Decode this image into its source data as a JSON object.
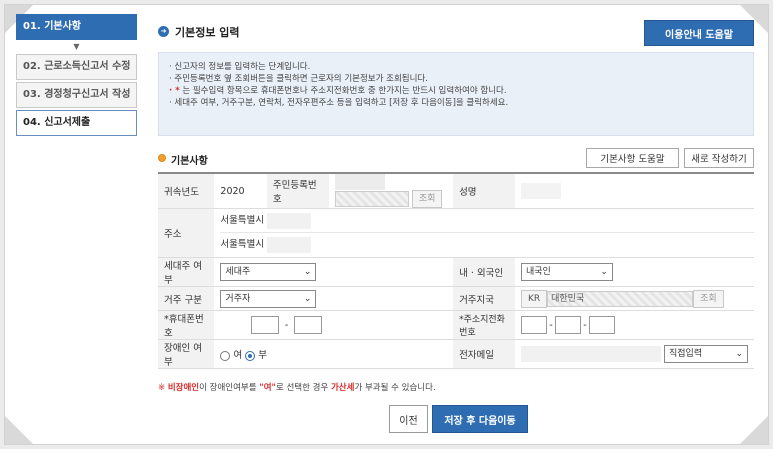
{
  "steps": [
    {
      "label": "01. 기본사항",
      "state": "active"
    },
    {
      "label": "02. 근로소득신고서 수정",
      "state": "normal"
    },
    {
      "label": "03. 경정청구신고서 작성",
      "state": "normal"
    },
    {
      "label": "04. 신고서제출",
      "state": "current"
    }
  ],
  "header": {
    "title": "기본정보 입력",
    "help_button": "이용안내 도움말"
  },
  "notice": {
    "lines": [
      "· 신고자의 정보를 입력하는 단계입니다.",
      "· 주민등록번호 옆 조회버튼을 클릭하면 근로자의 기본정보가 조회됩니다.",
      "는 필수입력 항목으로 휴대폰번호나 주소지전화번호 중 한가지는 반드시 입력하여야 합니다.",
      "· 세대주 여부, 거주구분, 연락처, 전자우편주소 등을 입력하고 [저장 후 다음이동]을 클릭하세요."
    ],
    "required_prefix": "· *"
  },
  "section": {
    "title": "기본사항",
    "help_button": "기본사항 도움말",
    "new_button": "새로 작성하기"
  },
  "form": {
    "year_label": "귀속년도",
    "year_value": "2020",
    "ssn_label": "주민등록번호",
    "lookup": "조회",
    "name_label": "성명",
    "address_label": "주소",
    "address_line1": "서울특별시",
    "address_line2": "서울특별시",
    "householder_label": "세대주 여부",
    "householder_value": "세대주",
    "nationality_label": "내 · 외국인",
    "nationality_value": "내국인",
    "residence_label": "거주 구분",
    "residence_value": "거주자",
    "country_label": "거주지국",
    "country_code": "KR",
    "country_name": "대한민국",
    "mobile_label": "*휴대폰번호",
    "home_phone_label": "*주소지전화번호",
    "disabled_label": "장애인 여부",
    "opt_yes": "여",
    "opt_no": "부",
    "email_label": "전자메일",
    "email_domain_select": "직접입력"
  },
  "warning": {
    "mark": "※",
    "t1": "비장애인",
    "t2": "이 장애인여부를 ",
    "t3": "\"여\"",
    "t4": "로 선택한 경우 ",
    "t5": "가산세",
    "t6": "가 부과될 수 있습니다."
  },
  "footer": {
    "prev": "이전",
    "next": "저장 후 다음이동"
  },
  "colors": {
    "accent": "#2f6db3",
    "required": "#d62b2b",
    "section_dot": "#f0a030"
  }
}
